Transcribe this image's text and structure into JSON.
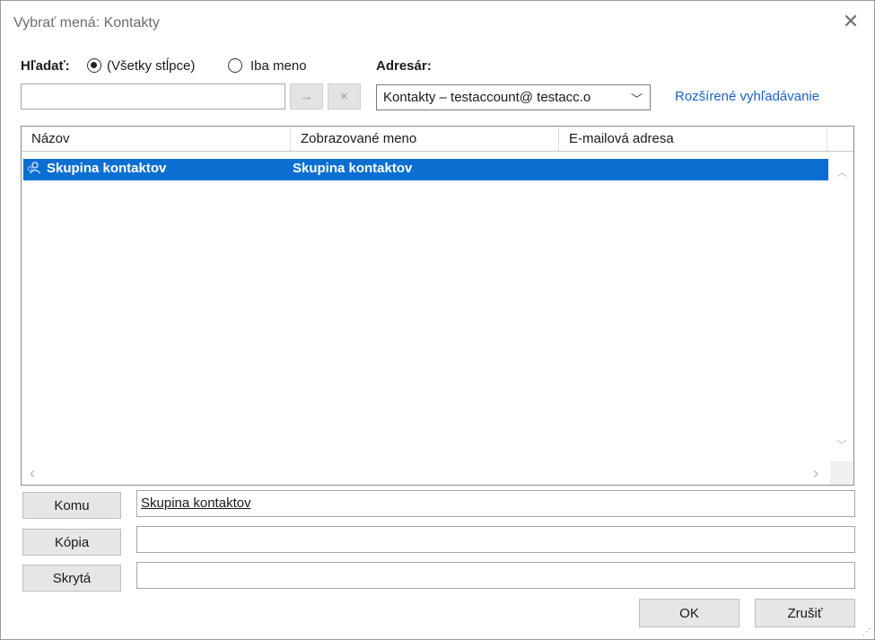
{
  "window": {
    "title": "Vybrať mená: Kontakty",
    "close_icon": "close-icon"
  },
  "search": {
    "label": "Hľadať:",
    "options": [
      {
        "label": "(Všetky stĺpce)",
        "checked": true
      },
      {
        "label": "Iba meno",
        "checked": false
      }
    ],
    "input_value": "",
    "go_symbol": "→",
    "clear_symbol": "×"
  },
  "address_book": {
    "label": "Adresár:",
    "selected": "Kontakty – testaccount@ testacc.o",
    "chevron": "﹀",
    "advanced_link": "Rozšírené vyhľadávanie"
  },
  "list": {
    "columns": [
      "Názov",
      "Zobrazované meno",
      "E-mailová adresa"
    ],
    "rows": [
      {
        "name": "Skupina kontaktov",
        "display_name": "Skupina kontaktov",
        "email": "",
        "icon": "contact-group-icon",
        "selected": true
      }
    ],
    "scroll_up": "︿",
    "scroll_down": "﹀",
    "scroll_left": "‹",
    "scroll_right": "›"
  },
  "recipients": {
    "to": {
      "label": "Komu",
      "value": "Skupina kontaktov"
    },
    "cc": {
      "label": "Kópia",
      "value": ""
    },
    "bcc": {
      "label": "Skrytá",
      "value": ""
    }
  },
  "buttons": {
    "ok": "OK",
    "cancel": "Zrušiť"
  },
  "colors": {
    "selection": "#0a6fd1",
    "link": "#1a64c6"
  }
}
